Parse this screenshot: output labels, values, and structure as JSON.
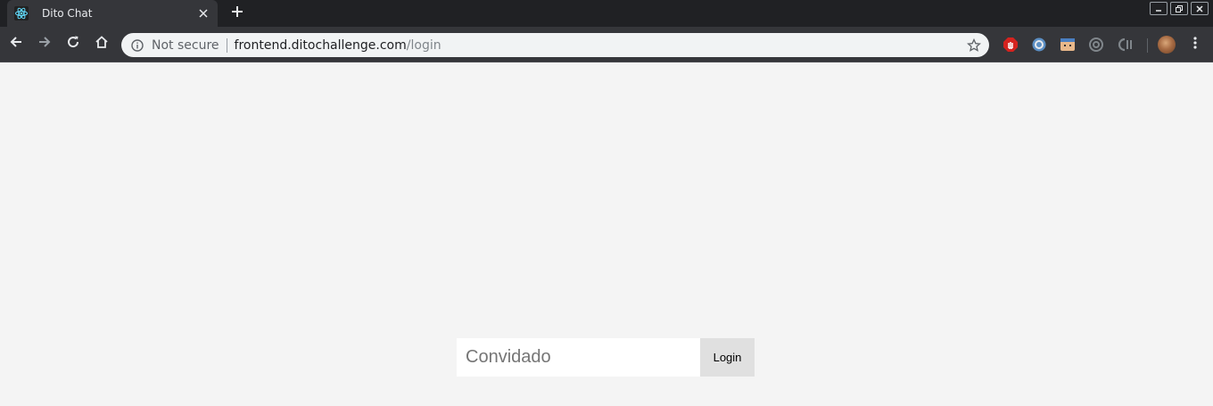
{
  "browser": {
    "tab": {
      "title": "Dito Chat"
    },
    "omnibox": {
      "security": "Not secure",
      "url_host": "frontend.ditochallenge.com",
      "url_path": "/login"
    }
  },
  "icons": {
    "favicon": "react-atom-icon",
    "close": "close-icon",
    "new_tab": "plus-icon",
    "back": "arrow-left-icon",
    "forward": "arrow-right-icon",
    "reload": "reload-icon",
    "home": "home-icon",
    "info": "info-icon",
    "bookmark": "star-icon",
    "menu": "three-dots-vertical-icon"
  },
  "colors": {
    "chrome_dark": "#202124",
    "toolbar": "#35363a",
    "page_bg": "#f4f4f4",
    "button_bg": "#e0e0e0",
    "react_cyan": "#61dafb"
  },
  "login": {
    "input_placeholder": "Convidado",
    "button_label": "Login"
  }
}
